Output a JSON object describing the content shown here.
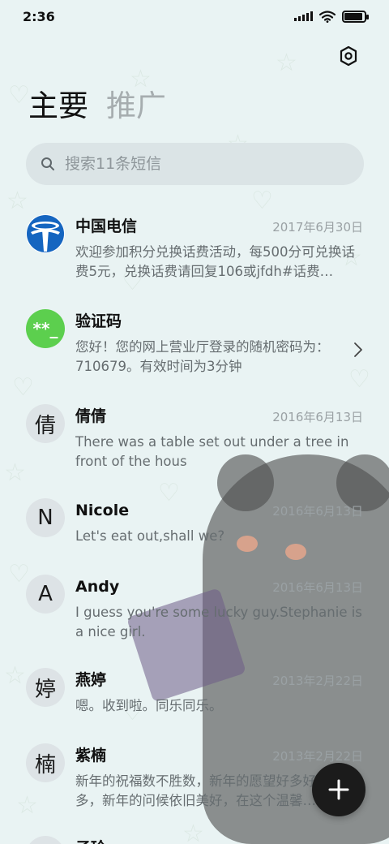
{
  "status": {
    "time": "2:36",
    "battery_level": 0.9
  },
  "icons": {
    "settings": "hexagon-settings-icon",
    "search": "search-icon",
    "compose": "plus-icon",
    "chevron": "chevron-right-icon"
  },
  "tabs": [
    {
      "label": "主要",
      "active": true
    },
    {
      "label": "推广",
      "active": false
    }
  ],
  "search": {
    "placeholder": "搜索11条短信"
  },
  "conversations": [
    {
      "name": "中国电信",
      "date": "2017年6月30日",
      "preview": "欢迎参加积分兑换话费活动，每500分可兑换话费5元，兑换话费请回复106或jfdh#话费…",
      "avatar_type": "logo",
      "avatar_text": ""
    },
    {
      "name": "验证码",
      "date": "",
      "preview": "您好！您的网上营业厅登录的随机密码为：710679。有效时间为3分钟",
      "avatar_type": "verify",
      "avatar_text": "**_"
    },
    {
      "name": "倩倩",
      "date": "2016年6月13日",
      "preview": "There was a table set out under a tree in front of the hous",
      "avatar_type": "letter",
      "avatar_text": "倩"
    },
    {
      "name": "Nicole",
      "date": "2016年6月13日",
      "preview": "Let's eat out,shall we?",
      "avatar_type": "letter",
      "avatar_text": "N"
    },
    {
      "name": "Andy",
      "date": "2016年6月13日",
      "preview": "I guess you're some lucky guy.Stephanie is a nice girl.",
      "avatar_type": "letter",
      "avatar_text": "A"
    },
    {
      "name": "燕婷",
      "date": "2013年2月22日",
      "preview": "嗯。收到啦。同乐同乐。",
      "avatar_type": "letter",
      "avatar_text": "婷"
    },
    {
      "name": "紫楠",
      "date": "2013年2月22日",
      "preview": "新年的祝福数不胜数，新年的愿望好多好多，新年的问候依旧美好，在这个温馨的时刻",
      "avatar_type": "letter",
      "avatar_text": "楠"
    },
    {
      "name": "子玲",
      "date": "",
      "preview": "",
      "avatar_type": "letter",
      "avatar_text": "玲"
    }
  ],
  "colors": {
    "background": "#e9f3f3",
    "fab": "#1b1b1b",
    "verify_avatar": "#5ccf4e",
    "telecom_blue": "#1565c0"
  }
}
